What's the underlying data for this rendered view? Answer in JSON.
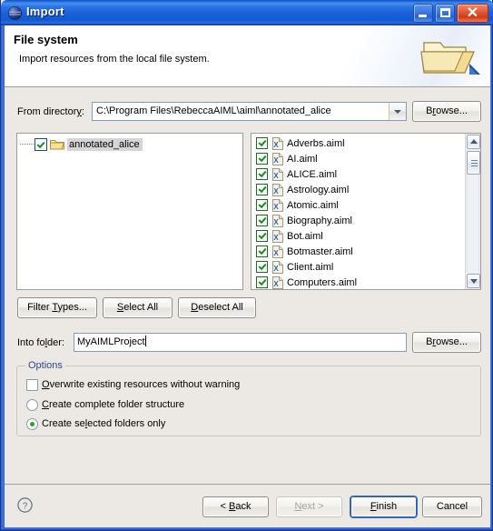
{
  "window": {
    "title": "Import",
    "icon": "import-sphere-icon",
    "controls": {
      "minimize": "minimize-button",
      "maximize": "maximize-button",
      "close": "close-button",
      "close_glyph": "✕"
    },
    "accent_title_color": "#1a62dc",
    "body_bg": "#ece9e4"
  },
  "header": {
    "title": "File system",
    "subtitle": "Import resources from the local file system.",
    "image": "open-folder-icon"
  },
  "from_directory": {
    "label_prefix": "From director",
    "label_underlined": "y",
    "label_suffix": ":",
    "value": "C:\\Program Files\\RebeccaAIML\\aiml\\annotated_alice",
    "browse_label_prefix": "B",
    "browse_label_underlined": "r",
    "browse_label_suffix": "owse..."
  },
  "tree": {
    "items": [
      {
        "label": "annotated_alice",
        "checked": true,
        "selected": true,
        "icon": "open-folder-icon"
      }
    ]
  },
  "file_list": {
    "items": [
      {
        "name": "Adverbs.aiml",
        "checked": true
      },
      {
        "name": "AI.aiml",
        "checked": true
      },
      {
        "name": "ALICE.aiml",
        "checked": true
      },
      {
        "name": "Astrology.aiml",
        "checked": true
      },
      {
        "name": "Atomic.aiml",
        "checked": true
      },
      {
        "name": "Biography.aiml",
        "checked": true
      },
      {
        "name": "Bot.aiml",
        "checked": true
      },
      {
        "name": "Botmaster.aiml",
        "checked": true
      },
      {
        "name": "Client.aiml",
        "checked": true
      },
      {
        "name": "Computers.aiml",
        "checked": true
      }
    ],
    "file_icon": "xml-file-icon",
    "scrollbar": {
      "up": "scroll-up-arrow-icon",
      "down": "scroll-down-arrow-icon",
      "thumb": "scroll-thumb"
    }
  },
  "list_buttons": [
    {
      "name": "filter-types-button",
      "prefix": "Filter ",
      "underlined": "T",
      "suffix": "ypes..."
    },
    {
      "name": "select-all-button",
      "prefix": "",
      "underlined": "S",
      "suffix": "elect All"
    },
    {
      "name": "deselect-all-button",
      "prefix": "",
      "underlined": "D",
      "suffix": "eselect All"
    }
  ],
  "into_folder": {
    "label_prefix": "Into fo",
    "label_underlined": "l",
    "label_suffix": "der:",
    "value": "MyAIMLProject",
    "browse_label_prefix": "B",
    "browse_label_underlined": "r",
    "browse_label_suffix": "owse..."
  },
  "options": {
    "group_title": "Options",
    "checkbox": {
      "prefix": "",
      "underlined": "O",
      "suffix": "verwrite existing resources without warning",
      "checked": false
    },
    "radios": [
      {
        "prefix": "",
        "underlined": "C",
        "suffix": "reate complete folder structure",
        "selected": false
      },
      {
        "prefix": "Create se",
        "underlined": "l",
        "suffix": "ected folders only",
        "selected": true
      }
    ]
  },
  "footer": {
    "help": "help-icon",
    "buttons": [
      {
        "name": "back-button",
        "prefix": "< ",
        "underlined": "B",
        "suffix": "ack",
        "disabled": false,
        "default": false
      },
      {
        "name": "next-button",
        "prefix": "",
        "underlined": "N",
        "suffix": "ext >",
        "disabled": true,
        "default": false
      },
      {
        "name": "finish-button",
        "prefix": "",
        "underlined": "F",
        "suffix": "inish",
        "disabled": false,
        "default": true
      },
      {
        "name": "cancel-button",
        "prefix": "",
        "underlined": "",
        "suffix": "Cancel",
        "disabled": false,
        "default": false
      }
    ]
  }
}
